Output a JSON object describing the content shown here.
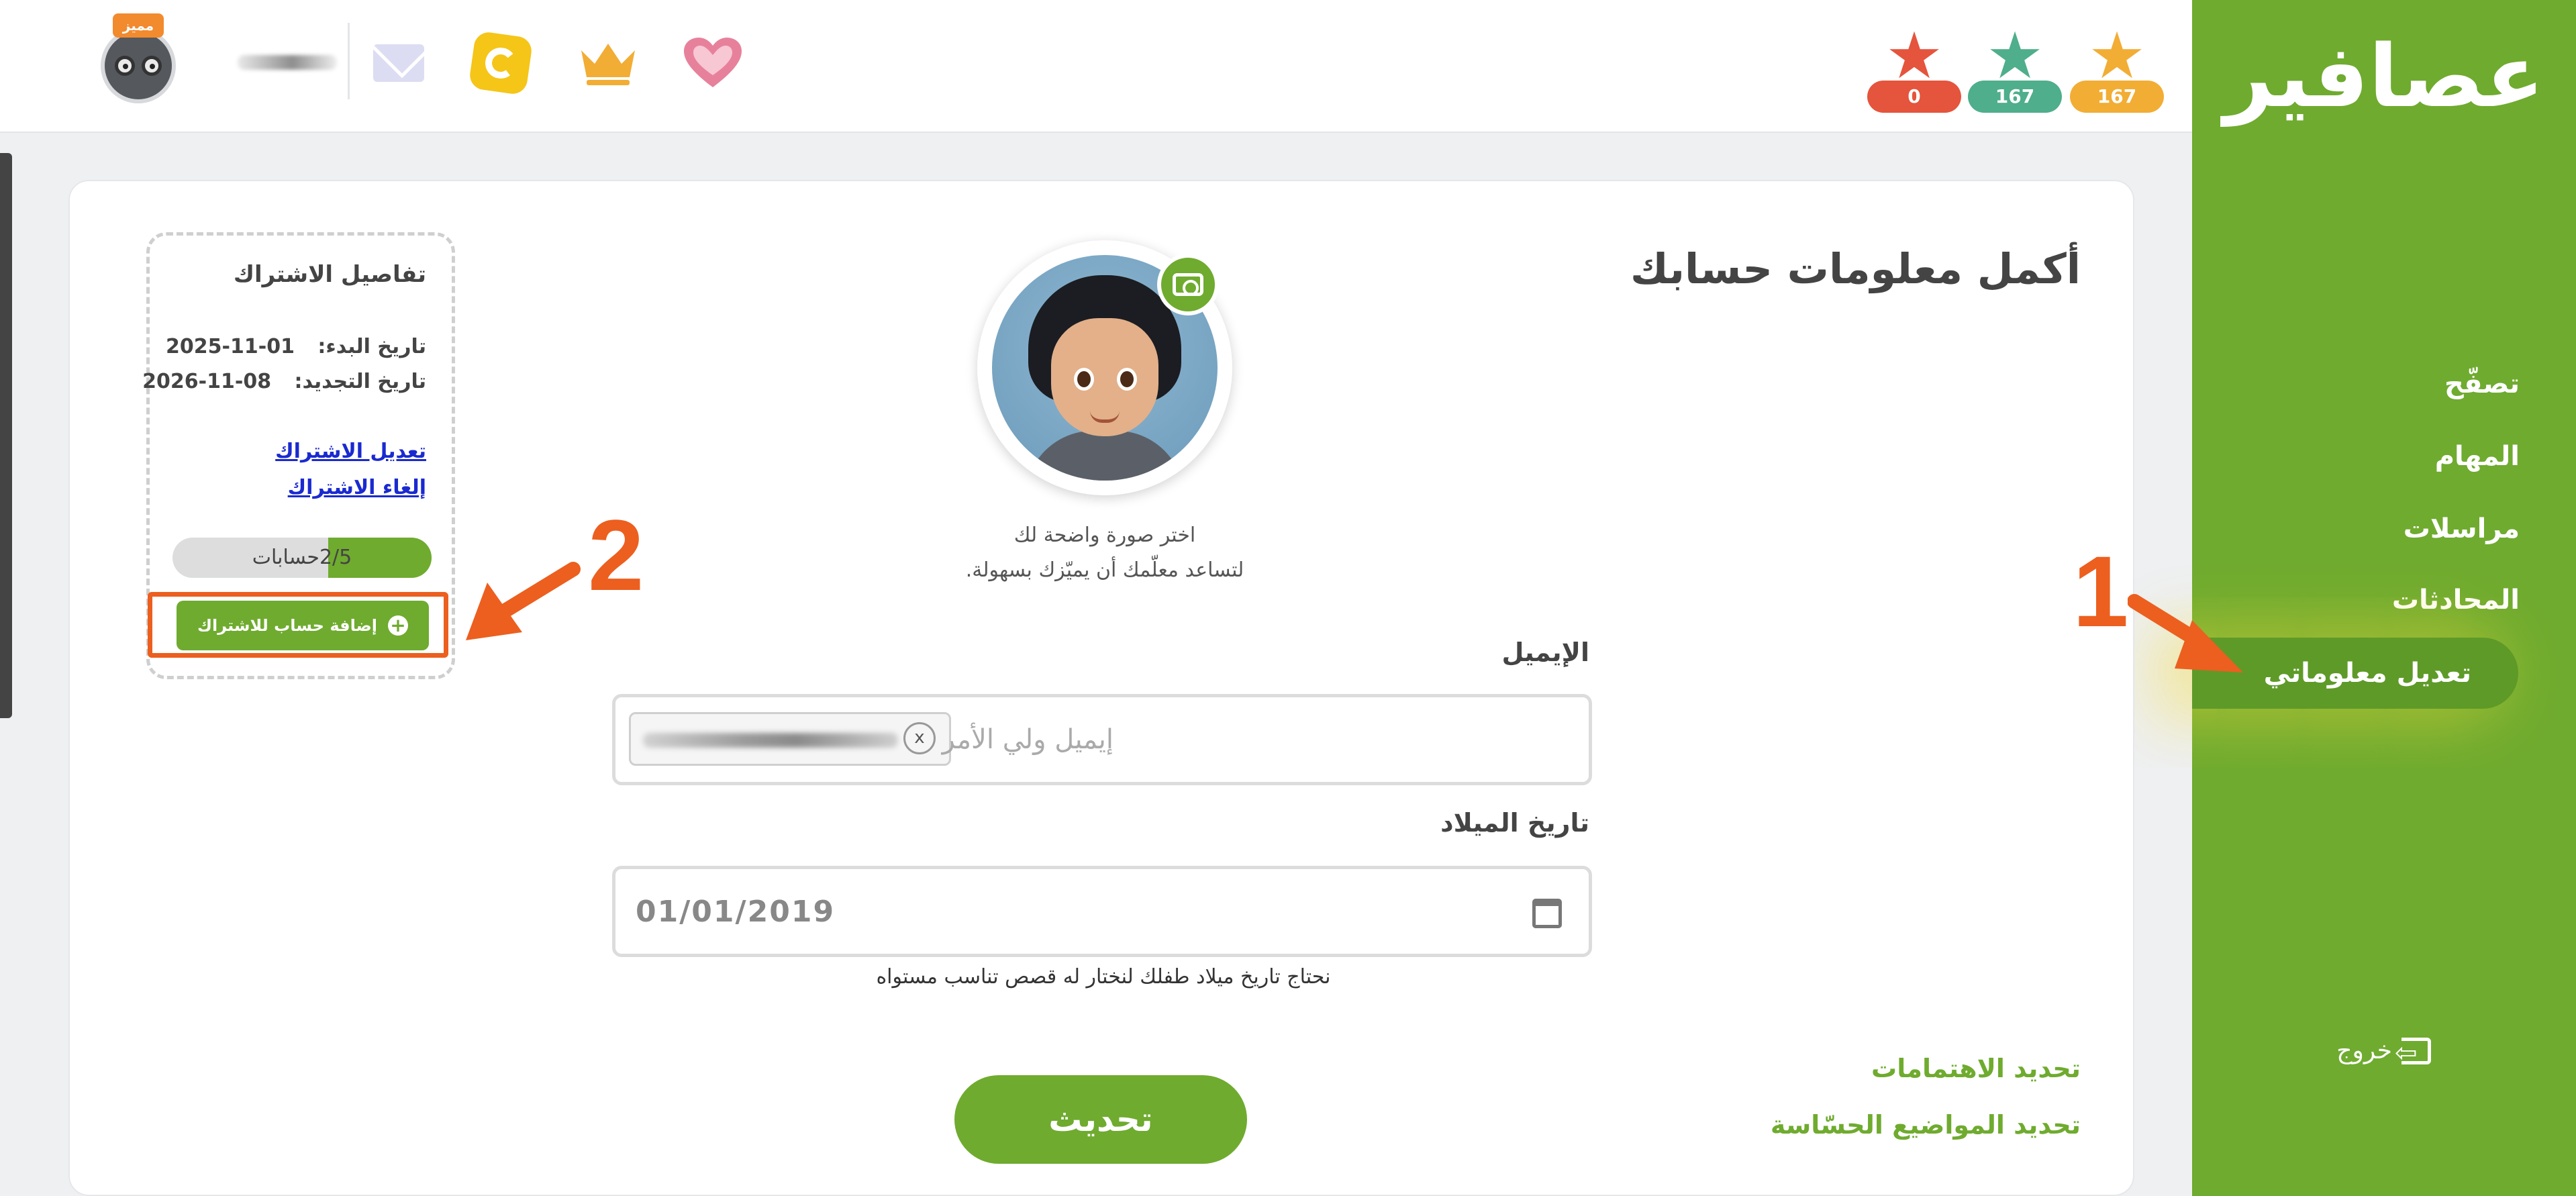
{
  "topbar": {
    "premium_badge": "مميز",
    "icons": [
      "envelope-icon",
      "coin-icon",
      "crown-icon",
      "heart-icon"
    ],
    "stars": [
      {
        "count": "0",
        "color": "#e5543c"
      },
      {
        "count": "167",
        "color": "#4fae8b"
      },
      {
        "count": "167",
        "color": "#f2ad35"
      }
    ]
  },
  "sidebar": {
    "logo": "عصافير",
    "items": [
      {
        "label": "تصفّح"
      },
      {
        "label": "المهام"
      },
      {
        "label": "مراسلات"
      },
      {
        "label": "المحادثات"
      },
      {
        "label": "تعديل معلوماتي"
      }
    ],
    "logout": "خروج"
  },
  "main": {
    "title": "أكمل معلومات حسابك",
    "photo_hint_1": "اختر صورة واضحة لك",
    "photo_hint_2": "لتساعد معلّمك أن يميّزك بسهولة.",
    "email_label": "الإيميل",
    "email_placeholder": "إيميل ولي الأمر",
    "chip_remove": "x",
    "birthdate_label": "تاريخ الميلاد",
    "birthdate_value": "01/01/2019",
    "birthdate_help": "نحتاج تاريخ ميلاد طفلك لنختار له قصص تناسب مستواه",
    "link_interests": "تحديد الاهتمامات",
    "link_sensitive": "تحديد المواضيع الحسّاسة",
    "update_button": "تحديث"
  },
  "subscription": {
    "title": "تفاصيل الاشتراك",
    "start_label": "تاريخ البدء:",
    "start_value": "2025-11-01",
    "renew_label": "تاريخ التجديد:",
    "renew_value": "2026-11-08",
    "edit_link": "تعديل الاشتراك",
    "cancel_link": "إلغاء الاشتراك",
    "accounts_text": "2/5حسابات",
    "accounts_used": 2,
    "accounts_total": 5,
    "add_button": "إضافة حساب للاشتراك"
  },
  "annotations": {
    "num_1": "1",
    "num_2": "2",
    "color": "#ec5f1f"
  },
  "colors": {
    "brand_green": "#6fab2f",
    "link_blue": "#1a2ad0"
  }
}
